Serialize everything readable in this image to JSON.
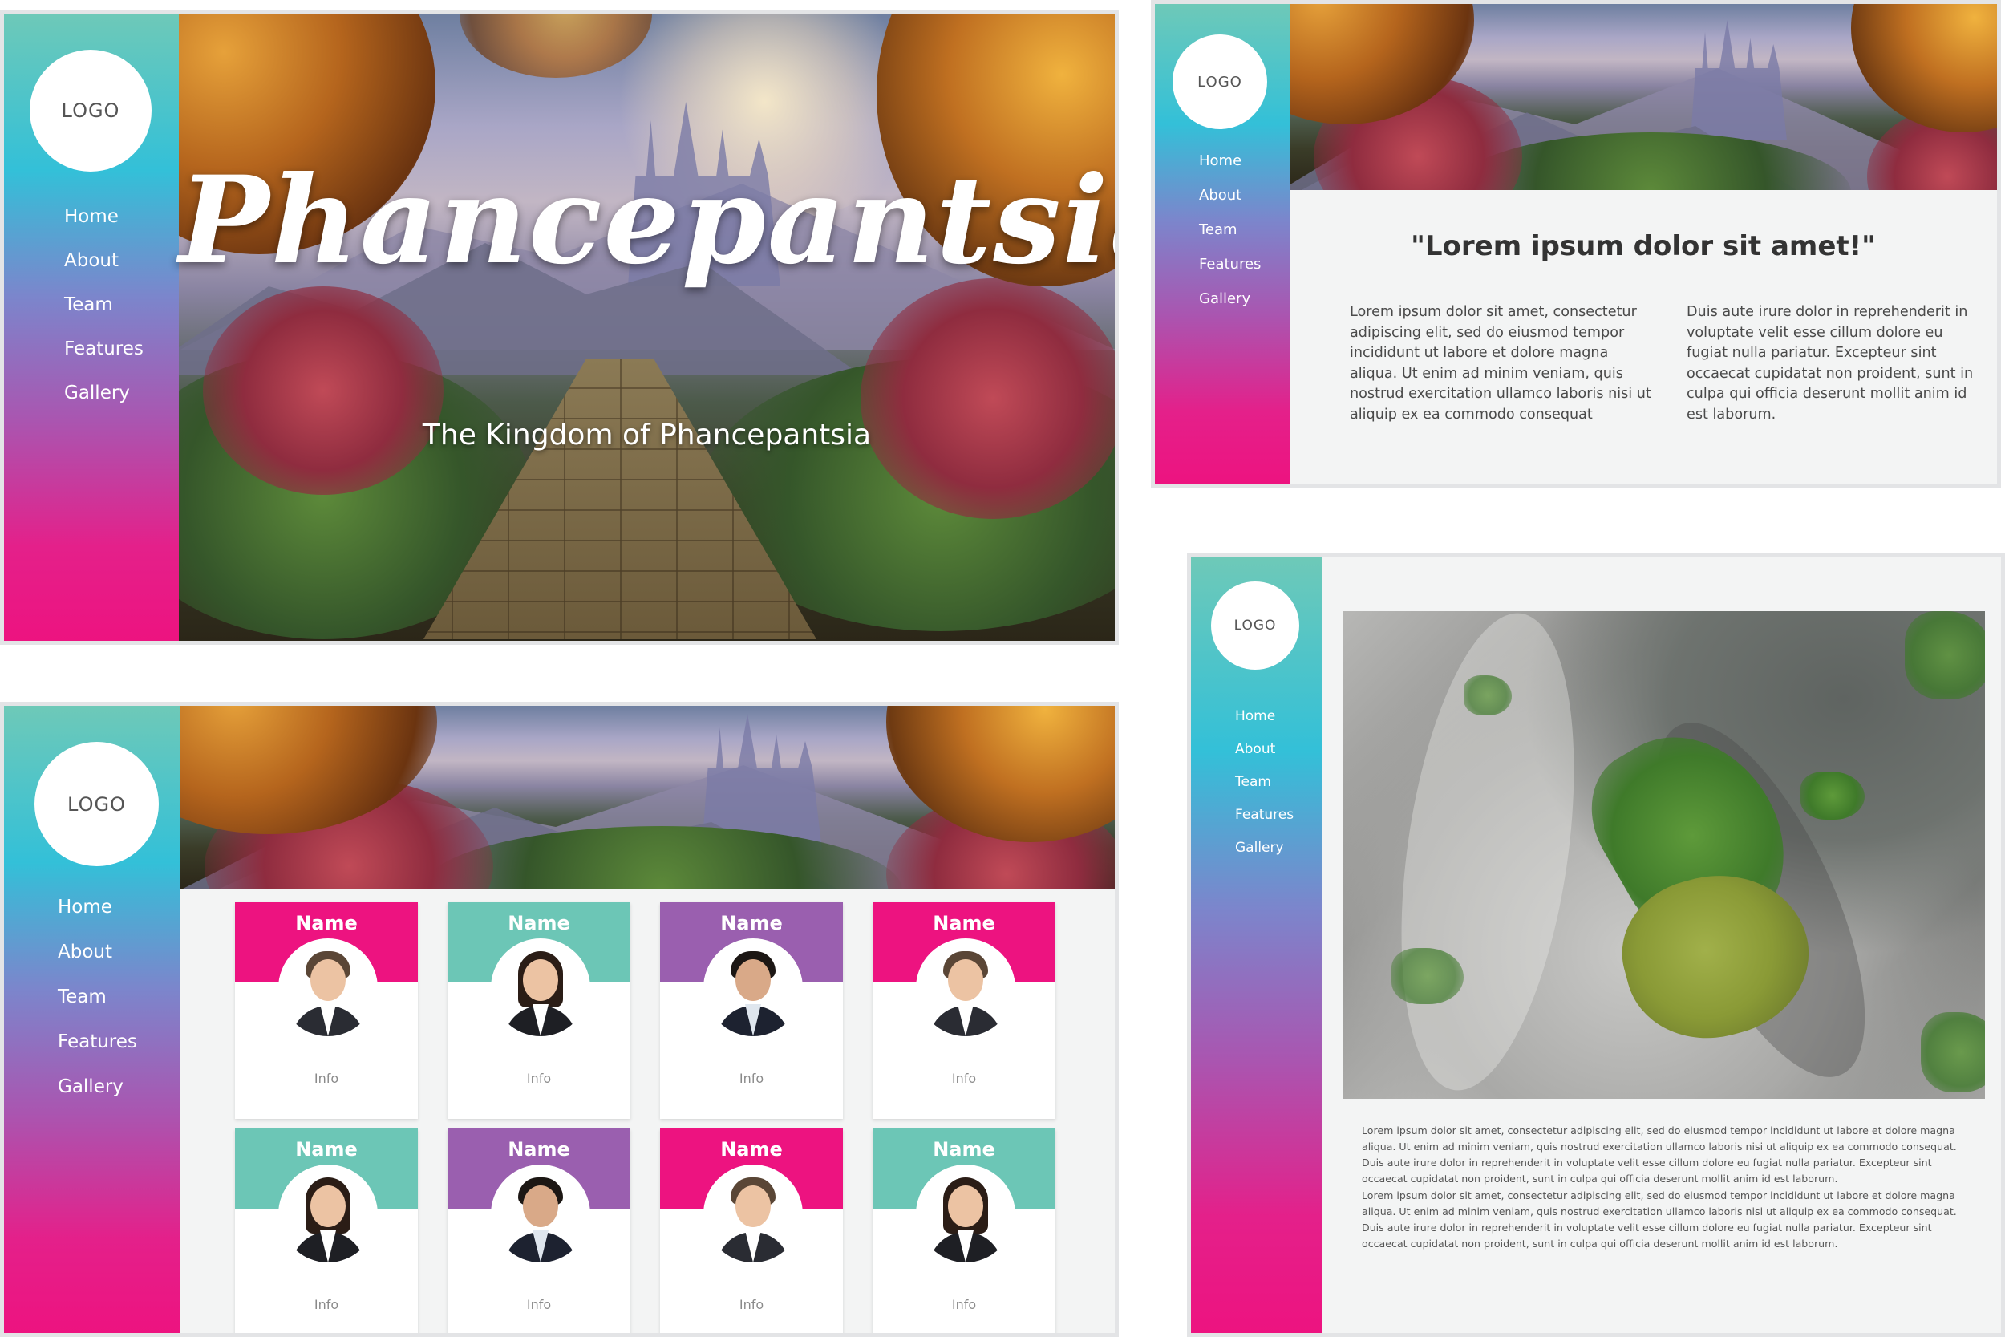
{
  "nav": [
    "Home",
    "About",
    "Team",
    "Features",
    "Gallery"
  ],
  "logo_text": "LOGO",
  "hero": {
    "title": "Phancepantsia",
    "subtitle": "The Kingdom of Phancepantsia"
  },
  "about": {
    "heading": "\"Lorem ipsum dolor sit amet!\"",
    "col1": "Lorem ipsum dolor sit amet, consectetur adipiscing elit, sed do eiusmod tempor incididunt ut labore et dolore magna aliqua. Ut enim ad minim veniam, quis nostrud exercitation ullamco laboris nisi ut aliquip ex ea commodo consequat",
    "col2": "Duis aute irure dolor in reprehenderit in voluptate velit esse cillum dolore eu fugiat nulla pariatur. Excepteur sint occaecat cupidatat non proident, sunt in culpa qui officia deserunt mollit anim id est laborum."
  },
  "team": {
    "cards": [
      {
        "name": "Name",
        "info": "Info"
      },
      {
        "name": "Name",
        "info": "Info"
      },
      {
        "name": "Name",
        "info": "Info"
      },
      {
        "name": "Name",
        "info": "Info"
      },
      {
        "name": "Name",
        "info": "Info"
      },
      {
        "name": "Name",
        "info": "Info"
      },
      {
        "name": "Name",
        "info": "Info"
      },
      {
        "name": "Name",
        "info": "Info"
      }
    ]
  },
  "gallery": {
    "para1": "Lorem ipsum dolor sit amet, consectetur adipiscing elit, sed do eiusmod tempor incididunt ut labore et dolore magna aliqua. Ut enim ad minim veniam, quis nostrud exercitation ullamco laboris nisi ut aliquip ex ea commodo consequat. Duis aute irure dolor in reprehenderit in voluptate velit esse cillum dolore eu fugiat nulla pariatur. Excepteur sint occaecat cupidatat non proident, sunt in culpa qui officia deserunt mollit anim id est laborum.",
    "para2": "Lorem ipsum dolor sit amet, consectetur adipiscing elit, sed do eiusmod tempor incididunt ut labore et dolore magna aliqua. Ut enim ad minim veniam, quis nostrud exercitation ullamco laboris nisi ut aliquip ex ea commodo consequat. Duis aute irure dolor in reprehenderit in voluptate velit esse cillum dolore eu fugiat nulla pariatur. Excepteur sint occaecat cupidatat non proident, sunt in culpa qui officia deserunt mollit anim id est laborum."
  },
  "colors": {
    "pink": "#ed1380",
    "teal": "#6cc6b6",
    "purple": "#9a5faf",
    "cyan": "#33c0d8"
  }
}
